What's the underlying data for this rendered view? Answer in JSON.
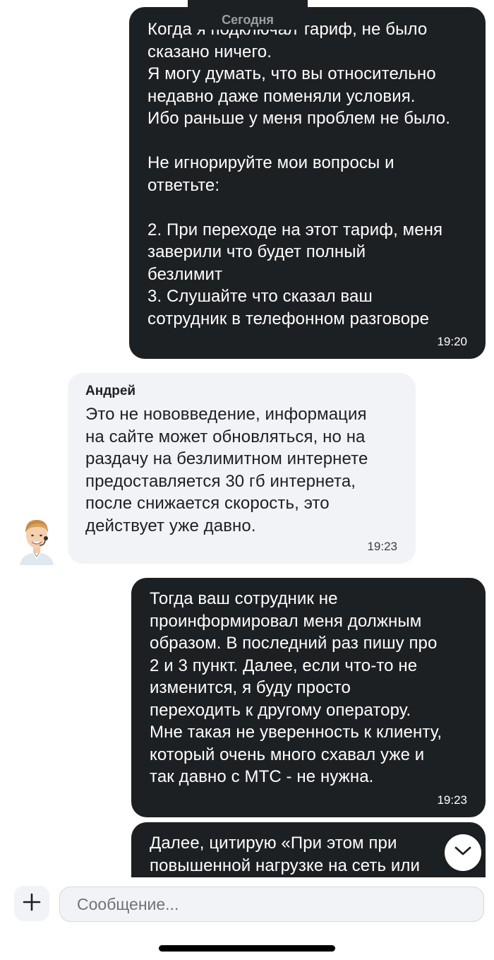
{
  "date_separator": "Сегодня",
  "messages": [
    {
      "direction": "outgoing",
      "text": "Когда я подключал тариф, не было\nсказано ничего.\nЯ могу думать, что вы относительно\nнедавно даже поменяли условия.\nИбо раньше у меня проблем не было.\n\nНе игнорируйте мои вопросы и\nответьте:\n\n2. При переходе на этот тариф, меня\nзаверили что будет полный\nбезлимит\n3. Слушайте что сказал ваш\nсотрудник в телефонном разговоре",
      "time": "19:20"
    },
    {
      "direction": "incoming",
      "sender": "Андрей",
      "text": "Это не нововведение, информация\nна сайте может обновляться, но на\nраздачу на безлимитном интернете\nпредоставляется 30 гб интернета,\nпосле снижается скорость, это\nдействует уже давно.",
      "time": "19:23"
    },
    {
      "direction": "outgoing",
      "text": "Тогда ваш сотрудник не\nпроинформировал меня должным\nобразом. В последний раз пишу про\n2 и 3 пункт. Далее, если что-то не\nизменится, я буду просто\nпереходить к другому оператору.\nМне такая не уверенность к клиенту,\nкоторый очень много схавал уже и\nтак давно с МТС - не нужна.",
      "time": "19:23"
    },
    {
      "direction": "outgoing",
      "text": "Далее, цитирую «При этом при\nповышенной нагрузке на сеть или"
    }
  ],
  "composer": {
    "placeholder": "Сообщение...",
    "value": ""
  },
  "icons": {
    "attach": "plus-icon",
    "scroll": "chevron-down-icon",
    "avatar": "operator-avatar"
  },
  "colors": {
    "outgoing_bubble": "#1d2023",
    "incoming_bubble": "#f2f3f7",
    "background": "#ffffff"
  }
}
